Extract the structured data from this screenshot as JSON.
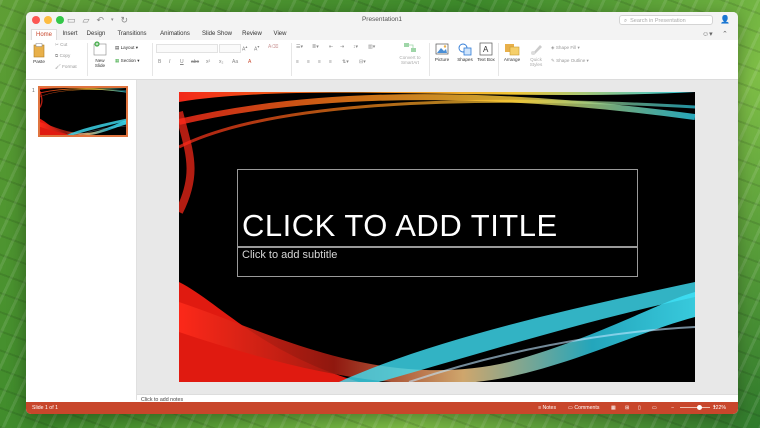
{
  "window": {
    "title": "Presentation1",
    "search_placeholder": "Search in Presentation",
    "traffic_lights": [
      "#fc5753",
      "#fdbc40",
      "#33c748"
    ]
  },
  "ribbon_tabs": [
    "Home",
    "Insert",
    "Design",
    "Transitions",
    "Animations",
    "Slide Show",
    "Review",
    "View"
  ],
  "active_tab": "Home",
  "ribbon": {
    "paste": "Paste",
    "cut": "Cut",
    "copy": "Copy",
    "format": "Format",
    "new_slide": "New Slide",
    "layout": "Layout",
    "section": "Section",
    "convert_to_smartart": "Convert to SmartArt",
    "picture": "Picture",
    "shapes": "Shapes",
    "text_box": "Text Box",
    "arrange": "Arrange",
    "quick_styles": "Quick Styles",
    "shape_fill": "Shape Fill",
    "shape_outline": "Shape Outline",
    "font_buttons": [
      "B",
      "I",
      "U",
      "abc",
      "x²",
      "x₂",
      "Aa",
      "A"
    ]
  },
  "thumbnails": [
    {
      "number": "1"
    }
  ],
  "slide": {
    "title_placeholder": "CLICK TO ADD TITLE",
    "subtitle_placeholder": "Click to add subtitle"
  },
  "notes_placeholder": "Click to add notes",
  "status": {
    "slide_indicator": "Slide 1 of 1",
    "notes": "Notes",
    "comments": "Comments",
    "zoom": "122%",
    "zoom_fraction": 0.65
  },
  "accent_color": "#c8462b"
}
